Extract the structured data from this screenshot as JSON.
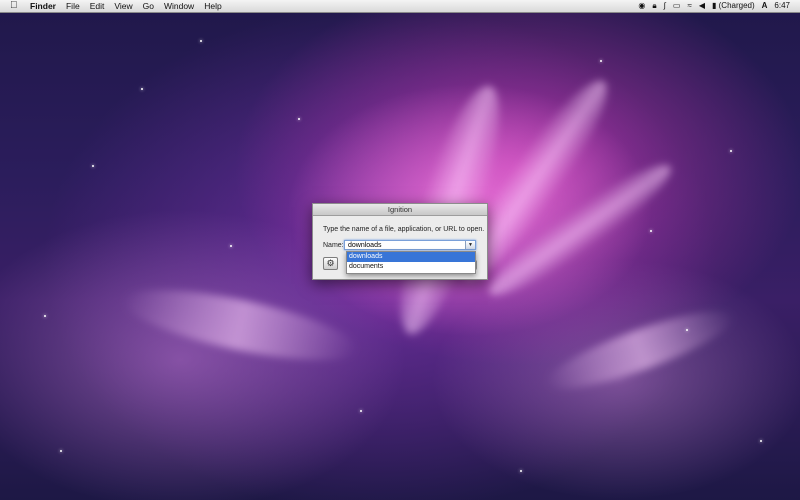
{
  "menubar": {
    "app_name": "Finder",
    "items": [
      "File",
      "Edit",
      "View",
      "Go",
      "Window",
      "Help"
    ],
    "status": {
      "icons": [
        "app-status-icon",
        "lock-icon",
        "bluetooth-icon",
        "display-icon",
        "wifi-icon",
        "volume-icon"
      ],
      "battery_text": "(Charged)",
      "input_menu": "A",
      "clock": "6:47"
    }
  },
  "dialog": {
    "title": "Ignition",
    "prompt": "Type the name of a file, application, or URL to open.",
    "name_label": "Name:",
    "name_value": "downloads",
    "suggestions": [
      "downloads",
      "documents"
    ],
    "selected_index": 0
  }
}
